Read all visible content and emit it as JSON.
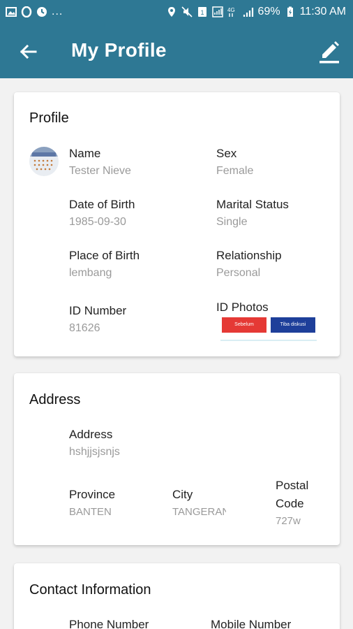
{
  "status_bar": {
    "more": "...",
    "battery": "69%",
    "time": "11:30 AM",
    "network": "4G"
  },
  "app_bar": {
    "title": "My Profile",
    "back_icon": "arrow-left-icon",
    "edit_icon": "pencil-icon"
  },
  "profile": {
    "title": "Profile",
    "name_label": "Name",
    "name_value": "Tester Nieve",
    "sex_label": "Sex",
    "sex_value": "Female",
    "dob_label": "Date of Birth",
    "dob_value": "1985-09-30",
    "marital_label": "Marital Status",
    "marital_value": "Single",
    "pob_label": "Place of Birth",
    "pob_value": "lembang",
    "relationship_label": "Relationship",
    "relationship_value": "Personal",
    "id_label": "ID Number",
    "id_value": "81626",
    "id_photos_label": "ID Photos",
    "id_photo_1": "Sebelum",
    "id_photo_2": "Tiba diskusi"
  },
  "address": {
    "title": "Address",
    "address_label": "Address",
    "address_value": "hshjjsjsnjs",
    "province_label": "Province",
    "province_value": "BANTEN",
    "city_label": "City",
    "city_value": "TANGERANG",
    "postal_label_1": "Postal",
    "postal_label_2": "Code",
    "postal_value": "727w"
  },
  "contact": {
    "title": "Contact Information",
    "phone_label": "Phone Number",
    "mobile_label": "Mobile Number"
  },
  "colors": {
    "primary": "#2e7894",
    "id_red": "#e53935",
    "id_blue": "#1e3f9a"
  }
}
